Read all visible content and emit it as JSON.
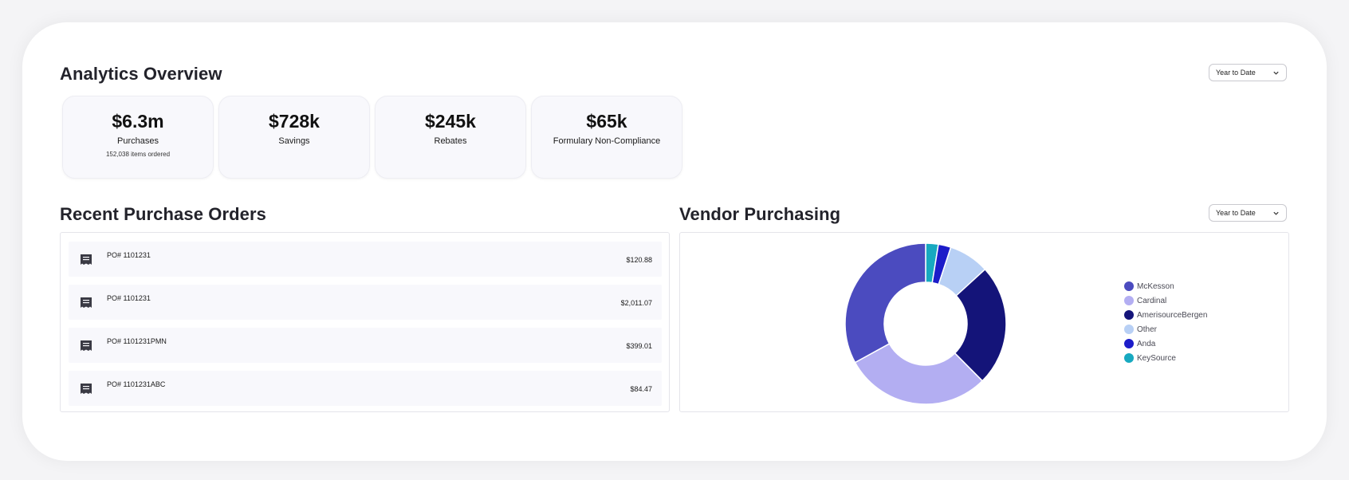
{
  "overview": {
    "title": "Analytics Overview",
    "range_label": "Year to Date",
    "kpis": [
      {
        "value": "$6.3m",
        "label": "Purchases",
        "sub": "152,038 items ordered"
      },
      {
        "value": "$728k",
        "label": "Savings",
        "sub": ""
      },
      {
        "value": "$245k",
        "label": "Rebates",
        "sub": ""
      },
      {
        "value": "$65k",
        "label": "Formulary Non-Compliance",
        "sub": ""
      }
    ]
  },
  "orders": {
    "title": "Recent Purchase Orders",
    "items": [
      {
        "po": "PO# 1101231",
        "amount": "$120.88"
      },
      {
        "po": "PO# 1101231",
        "amount": "$2,011.07"
      },
      {
        "po": "PO# 1101231PMN",
        "amount": "$399.01"
      },
      {
        "po": "PO# 1101231ABC",
        "amount": "$84.47"
      }
    ]
  },
  "vendors": {
    "title": "Vendor Purchasing",
    "range_label": "Year to Date"
  },
  "chart_data": {
    "type": "pie",
    "title": "",
    "categories": [
      "McKesson",
      "Cardinal",
      "AmerisourceBergen",
      "Other",
      "Anda",
      "KeySource"
    ],
    "values": [
      32.5,
      29,
      24,
      8,
      2.5,
      2.5
    ],
    "colors": [
      "#4b4bbf",
      "#b3aef2",
      "#141479",
      "#b8d0f5",
      "#1c1cc9",
      "#17a9c0"
    ],
    "legend_position": "right"
  }
}
